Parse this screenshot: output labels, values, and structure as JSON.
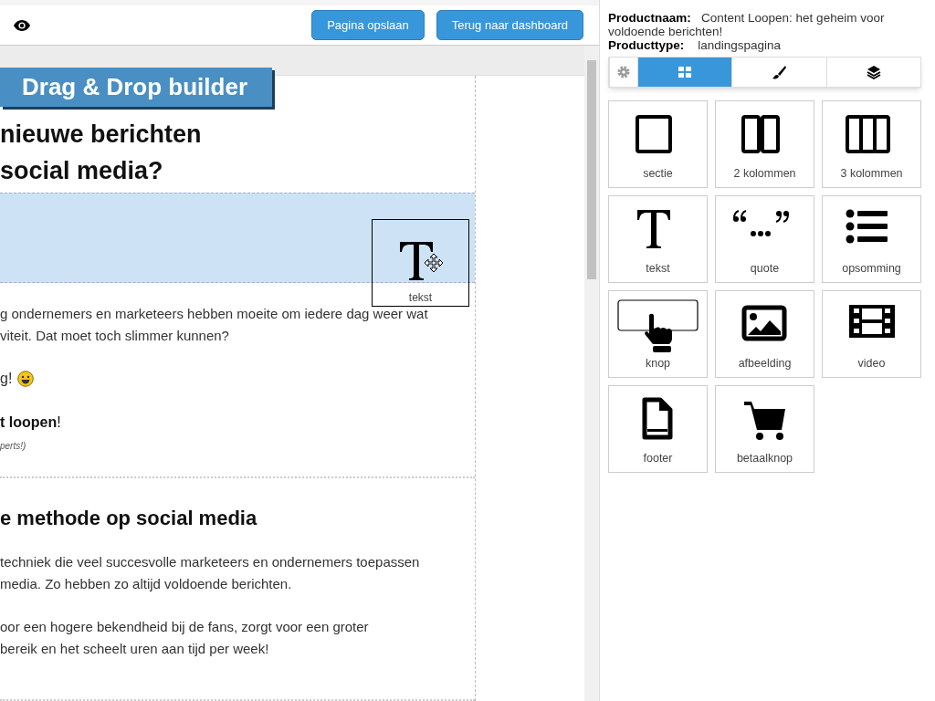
{
  "toolbar": {
    "buttons": [
      "Pagina opslaan",
      "Terug naar dashboard"
    ]
  },
  "builder_banner": "Drag & Drop builder",
  "canvas": {
    "sections": [
      {
        "heading_lines": [
          "nieuwe berichten",
          "social media?"
        ],
        "highlighted": true,
        "paragraphs": [
          [
            "g ondernemers en marketeers hebben moeite om iedere dag weer wat",
            "viteit. Dat moet toch slimmer kunnen?"
          ]
        ],
        "emoji_line": "g!",
        "bold_line": "**t loopen**!",
        "small_note": "perts!)"
      },
      {
        "heading_lines": [
          "e methode op social media"
        ],
        "highlighted": false,
        "paragraphs": [
          [
            "techniek die veel succesvolle marketeers en ondernemers toepassen",
            "media. Zo hebben zo altijd voldoende berichten."
          ],
          [
            "oor een hogere bekendheid bij de fans, zorgt voor een groter",
            "bereik en het scheelt uren aan tijd per week!"
          ]
        ]
      }
    ]
  },
  "drag_ghost": {
    "kind": "text",
    "label": "tekst"
  },
  "product": {
    "name_label": "Productnaam:",
    "name": "Content Loopen: het geheim voor voldoende berichten!",
    "type_label": "Producttype:",
    "type": "landingspagina"
  },
  "tabs": [
    {
      "kind": "settings",
      "selected": false
    },
    {
      "kind": "blocks",
      "selected": true
    },
    {
      "kind": "brush",
      "selected": false
    },
    {
      "kind": "layers",
      "selected": false
    }
  ],
  "blocks": [
    {
      "kind": "section",
      "label": "sectie"
    },
    {
      "kind": "columns2",
      "label": "2 kolommen"
    },
    {
      "kind": "columns3",
      "label": "3 kolommen"
    },
    {
      "kind": "text",
      "label": "tekst"
    },
    {
      "kind": "quote",
      "label": "quote"
    },
    {
      "kind": "list",
      "label": "opsomming"
    },
    {
      "kind": "button",
      "label": "knop"
    },
    {
      "kind": "image",
      "label": "afbeelding"
    },
    {
      "kind": "video",
      "label": "video"
    },
    {
      "kind": "footer",
      "label": "footer"
    },
    {
      "kind": "cart",
      "label": "betaalknop"
    }
  ]
}
